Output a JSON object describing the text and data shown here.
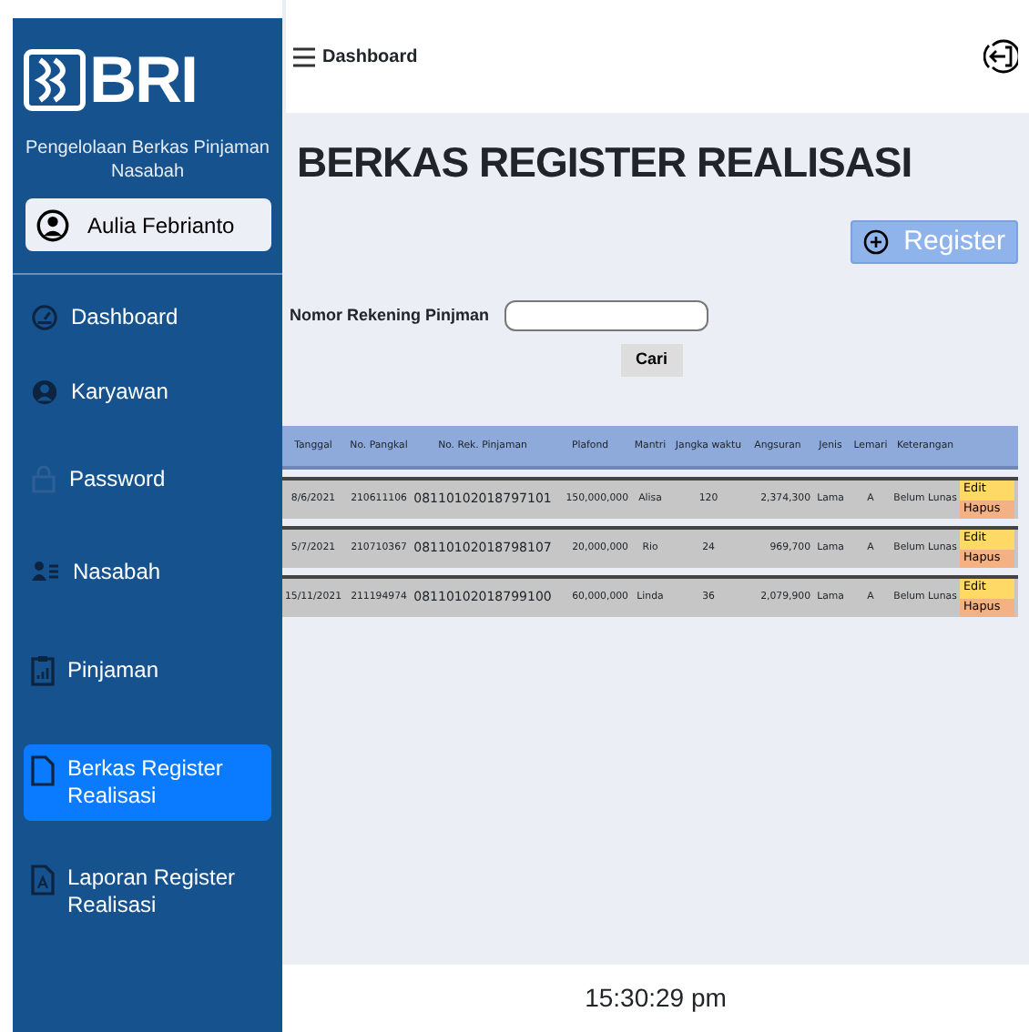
{
  "sidebar": {
    "logo": "BRI",
    "subtitle": "Pengelolaan Berkas Pinjaman Nasabah",
    "user": "Aulia Febrianto",
    "items": [
      {
        "label": "Dashboard",
        "selected": false
      },
      {
        "label": "Karyawan",
        "selected": false
      },
      {
        "label": "Password",
        "selected": false
      },
      {
        "label": "Nasabah",
        "selected": false
      },
      {
        "label": "Pinjaman",
        "selected": false
      },
      {
        "label": "Berkas Register Realisasi",
        "selected": true
      },
      {
        "label": "Laporan Register Realisasi",
        "selected": false
      }
    ]
  },
  "header": {
    "title": "Dashboard"
  },
  "page_title": "BERKAS REGISTER REALISASI",
  "register_button": "Register",
  "search": {
    "label": "Nomor Rekening Pinjman",
    "button": "Cari"
  },
  "table": {
    "columns": [
      "Tanggal",
      "No. Pangkal",
      "No. Rek. Pinjaman",
      "Plafond",
      "Mantri",
      "Jangka waktu",
      "Angsuran",
      "Jenis",
      "Lemari",
      "Keterangan"
    ],
    "rows": [
      {
        "cells": [
          "8/6/2021",
          "210611106",
          "08110102018797101",
          "150,000,000",
          "Alisa",
          "120",
          "2,374,300",
          "Lama",
          "A",
          "Belum Lunas"
        ],
        "edit": "Edit",
        "delete": "Hapus"
      },
      {
        "cells": [
          "5/7/2021",
          "210710367",
          "08110102018798107",
          "20,000,000",
          "Rio",
          "24",
          "969,700",
          "Lama",
          "A",
          "Belum Lunas"
        ],
        "edit": "Edit",
        "delete": "Hapus"
      },
      {
        "cells": [
          "15/11/2021",
          "211194974",
          "08110102018799100",
          "60,000,000",
          "Linda",
          "36",
          "2,079,900",
          "Lama",
          "A",
          "Belum Lunas"
        ],
        "edit": "Edit",
        "delete": "Hapus"
      }
    ]
  },
  "footer": {
    "time": "15:30:29 pm"
  }
}
